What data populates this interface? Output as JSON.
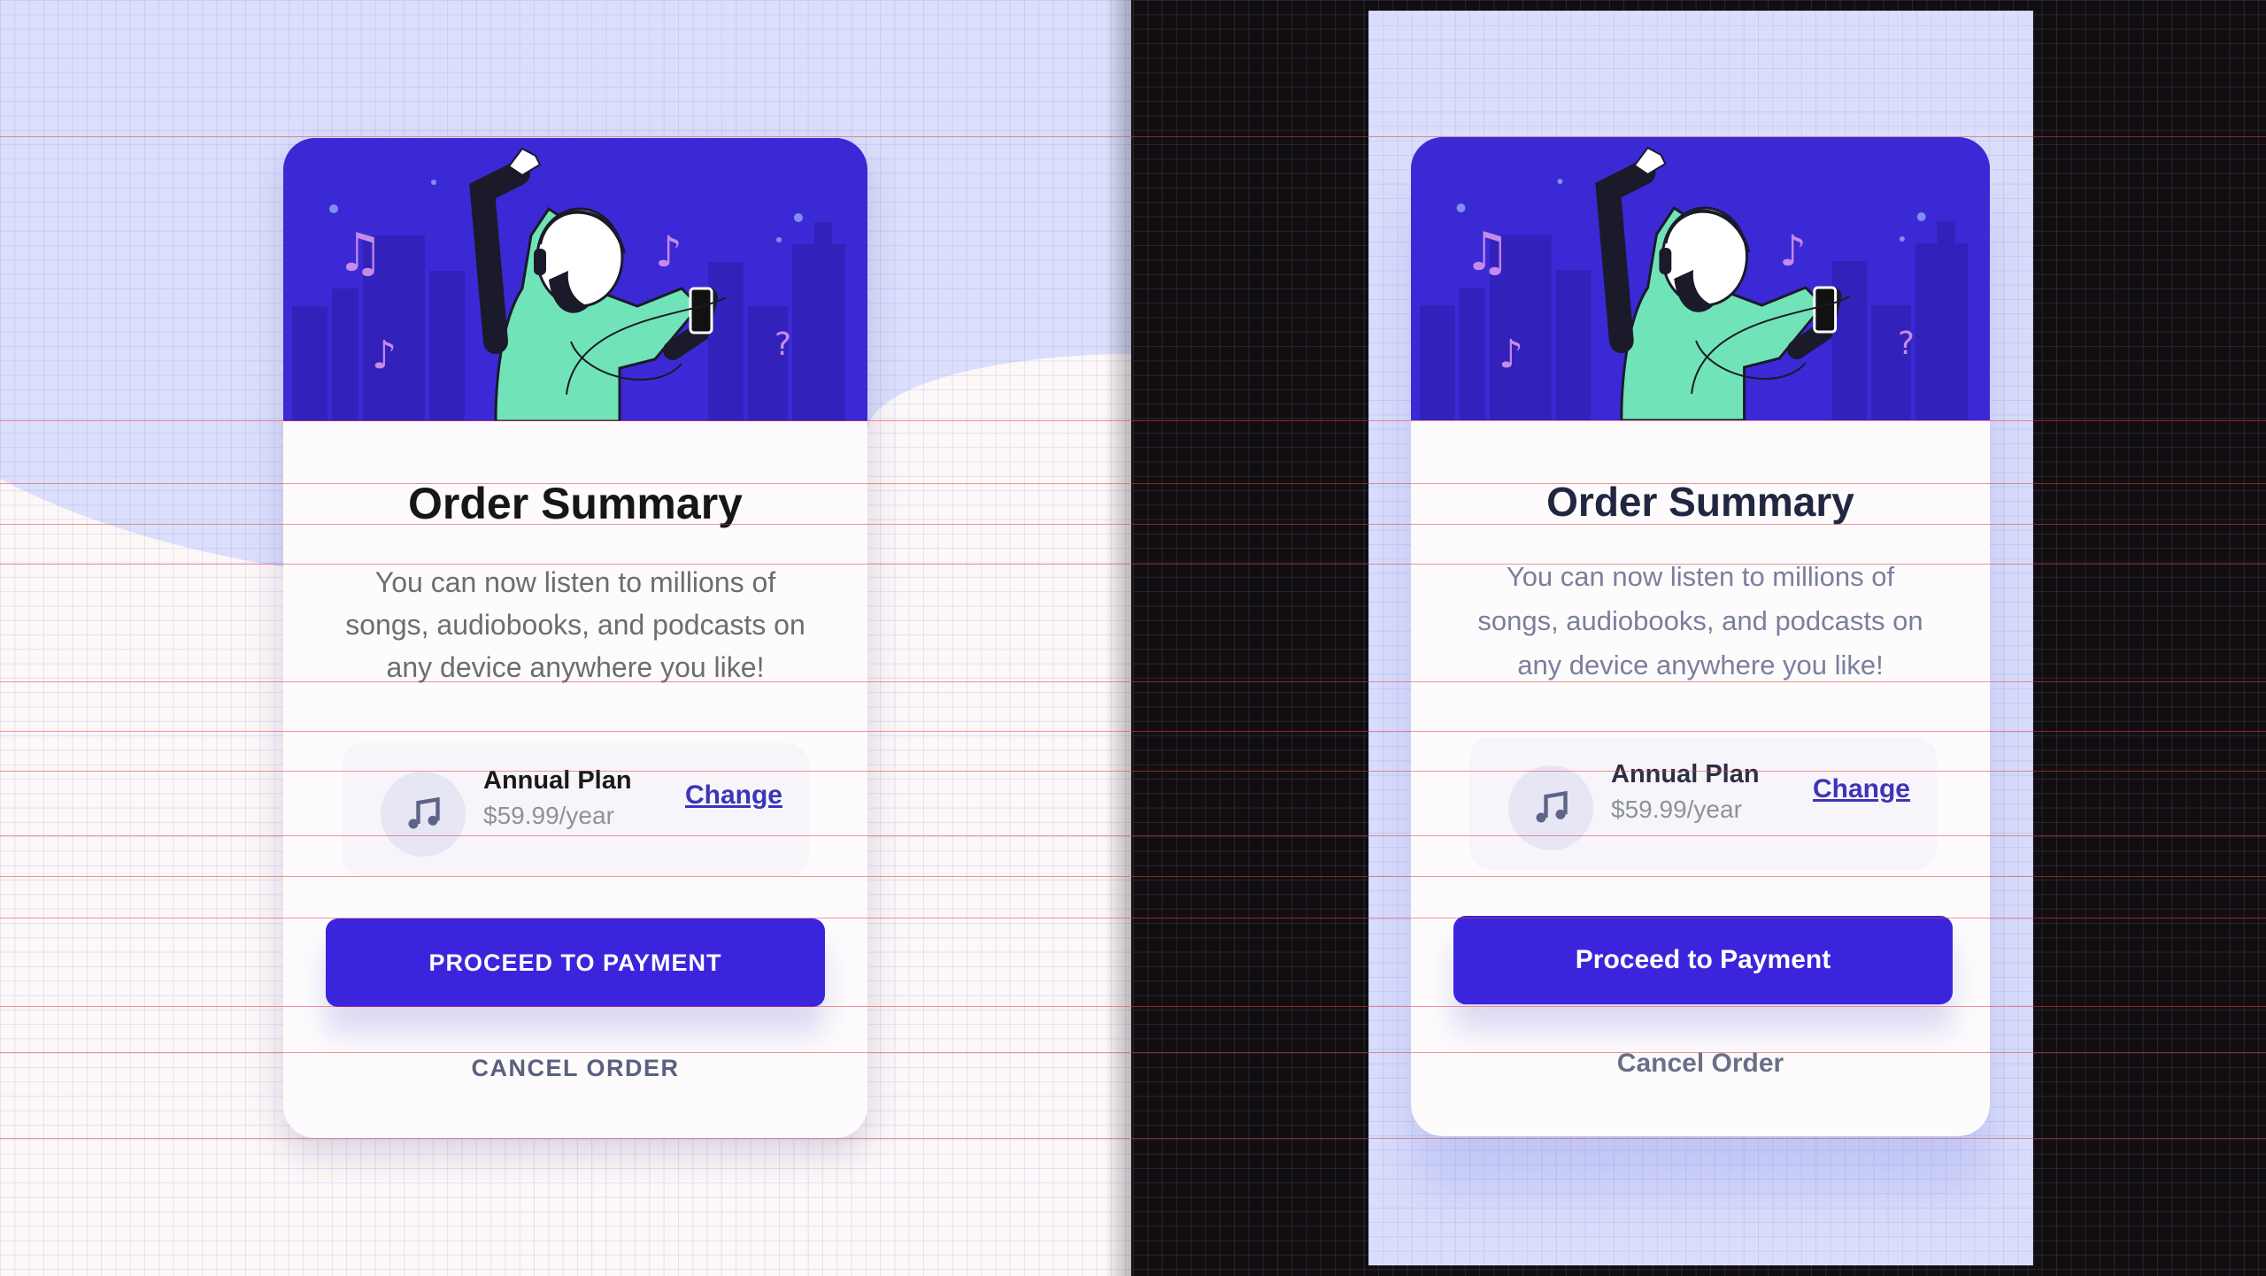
{
  "variants": {
    "left": {
      "title": "Order Summary",
      "description": "You can now listen to millions of songs, audiobooks, and podcasts on any device anywhere you like!",
      "plan_name": "Annual Plan",
      "plan_price": "$59.99/year",
      "change_label": "Change",
      "cta_label": "PROCEED TO PAYMENT",
      "cancel_label": "CANCEL ORDER"
    },
    "right": {
      "title": "Order Summary",
      "description": "You can now listen to millions of songs, audiobooks, and podcasts on any device anywhere you like!",
      "plan_name": "Annual Plan",
      "plan_price": "$59.99/year",
      "change_label": "Change",
      "cta_label": "Proceed to Payment",
      "cancel_label": "Cancel Order"
    }
  },
  "icons": {
    "plan": "music-note-icon",
    "hero": "woman-listening-music-illustration"
  },
  "colors": {
    "hero_bg": "#3b29d6",
    "primary_button": "#3b25dc",
    "link": "#3d35b8",
    "page_bg": "#dcdffb",
    "overlay_grid": "#7896e6",
    "guide_lines": "#e63c46"
  }
}
